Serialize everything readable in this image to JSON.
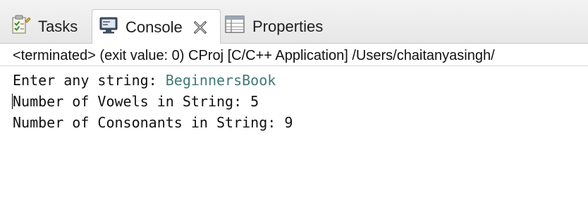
{
  "tabs": {
    "tasks": {
      "label": "Tasks",
      "icon": "tasks-icon"
    },
    "console": {
      "label": "Console",
      "icon": "console-icon",
      "active": true
    },
    "properties": {
      "label": "Properties",
      "icon": "properties-icon"
    }
  },
  "status": {
    "text": "<terminated> (exit value: 0) CProj [C/C++ Application] /Users/chaitanyasingh/"
  },
  "console_output": {
    "prompt": "Enter any string: ",
    "input": "BeginnersBook",
    "vowels": "Number of Vowels in String: 5",
    "consonants": "Number of Consonants in String: 9"
  },
  "colors": {
    "user_input": "#3f7a78",
    "tab_bar": "#ececec"
  }
}
